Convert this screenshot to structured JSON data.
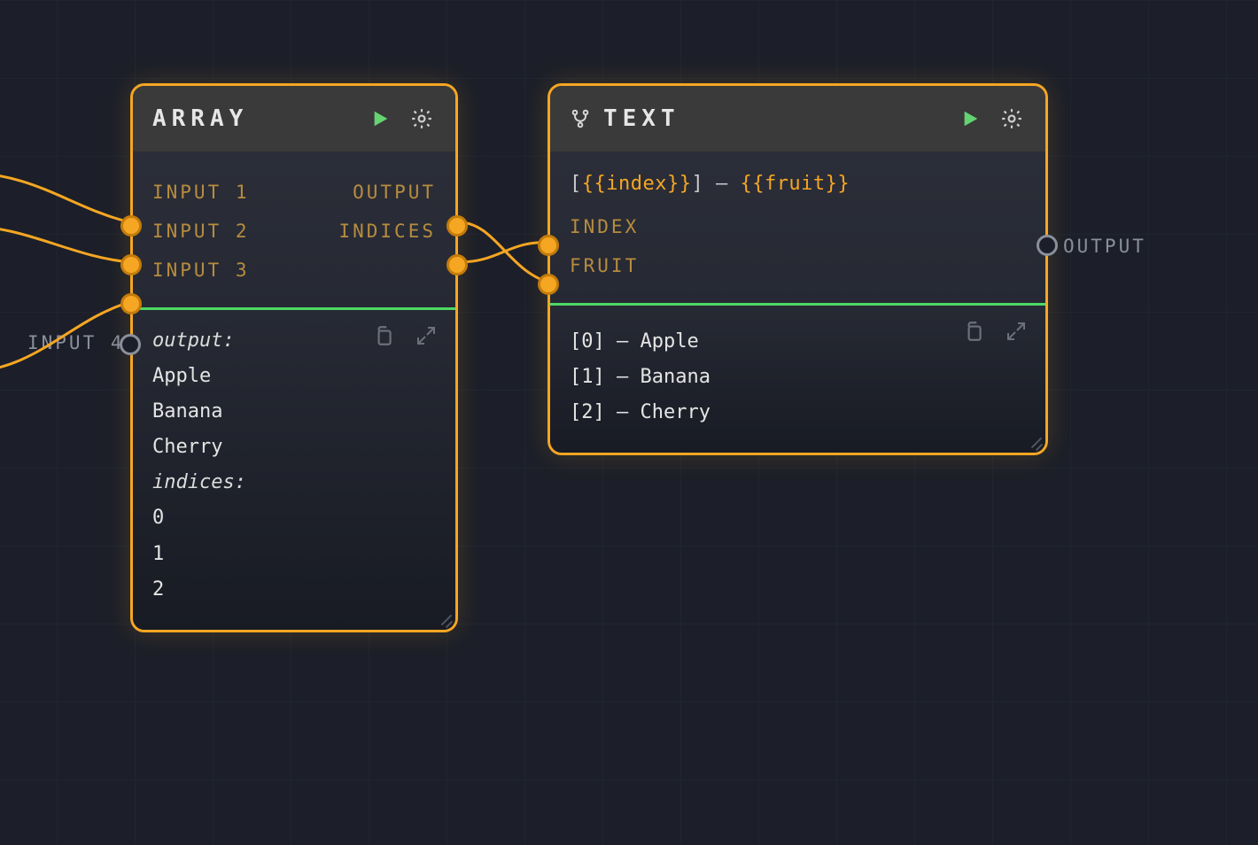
{
  "arrayNode": {
    "title": "ARRAY",
    "inputs": [
      "INPUT 1",
      "INPUT 2",
      "INPUT 3"
    ],
    "extraInputLabel": "INPUT 4",
    "outputs": [
      "OUTPUT",
      "INDICES"
    ],
    "result": {
      "outputLabel": "output:",
      "outputValues": [
        "Apple",
        "Banana",
        "Cherry"
      ],
      "indicesLabel": "indices:",
      "indicesValues": [
        "0",
        "1",
        "2"
      ]
    }
  },
  "textNode": {
    "title": "TEXT",
    "template": {
      "prefix": "[",
      "var1": "{{index}}",
      "mid": "] – ",
      "var2": "{{fruit}}"
    },
    "inputs": [
      "INDEX",
      "FRUIT"
    ],
    "outputLabel": "OUTPUT",
    "lines": [
      "[0] – Apple",
      "[1] – Banana",
      "[2] – Cherry"
    ]
  }
}
